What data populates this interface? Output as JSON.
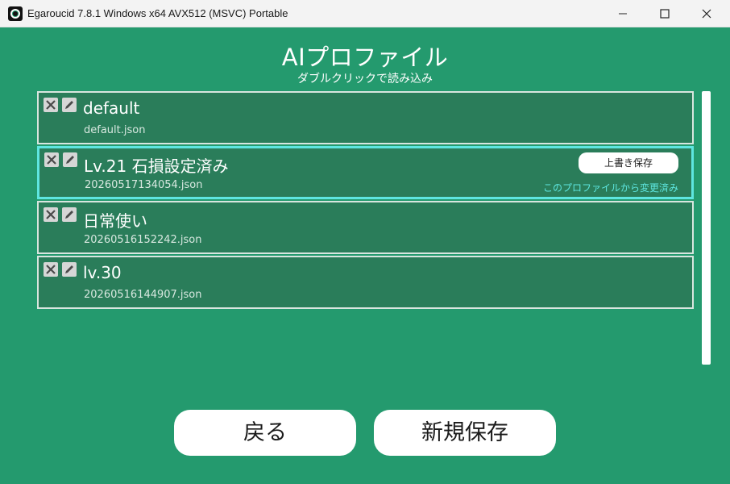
{
  "window": {
    "title": "Egaroucid 7.8.1 Windows x64 AVX512 (MSVC) Portable"
  },
  "header": {
    "title": "AIプロファイル",
    "subtitle": "ダブルクリックで読み込み"
  },
  "profiles": [
    {
      "name": "default",
      "file": "default.json"
    },
    {
      "name": "Lv.21 石損設定済み",
      "file": "20260517134054.json",
      "overwrite_label": "上書き保存",
      "modified_note": "このプロファイルから変更済み"
    },
    {
      "name": "日常使い",
      "file": "20260516152242.json"
    },
    {
      "name": "lv.30",
      "file": "20260516144907.json"
    }
  ],
  "footer": {
    "back_label": "戻る",
    "new_save_label": "新規保存"
  },
  "colors": {
    "background": "#249a6e",
    "item_background": "#2a7d5a",
    "selected_border": "#5ee6e0"
  }
}
